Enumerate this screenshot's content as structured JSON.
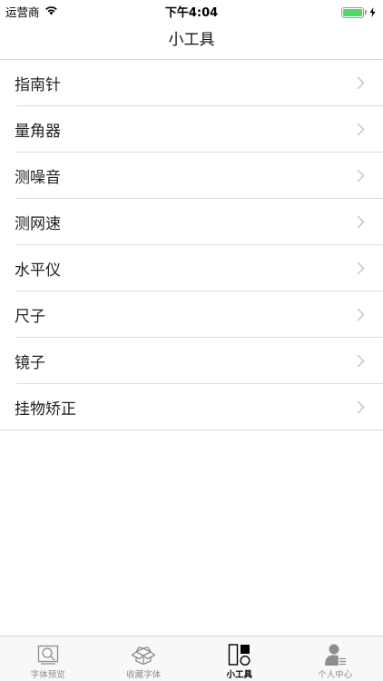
{
  "status_bar": {
    "carrier": "运营商",
    "time": "下午4:04",
    "battery_level": 1.0
  },
  "nav": {
    "title": "小工具"
  },
  "tools": [
    {
      "label": "指南针",
      "icon": "chevron-right-icon"
    },
    {
      "label": "量角器",
      "icon": "chevron-right-icon"
    },
    {
      "label": "测噪音",
      "icon": "chevron-right-icon"
    },
    {
      "label": "测网速",
      "icon": "chevron-right-icon"
    },
    {
      "label": "水平仪",
      "icon": "chevron-right-icon"
    },
    {
      "label": "尺子",
      "icon": "chevron-right-icon"
    },
    {
      "label": "镜子",
      "icon": "chevron-right-icon"
    },
    {
      "label": "挂物矫正",
      "icon": "chevron-right-icon"
    }
  ],
  "tab_bar": {
    "tabs": [
      {
        "label": "字体预览",
        "icon": "font-preview-icon",
        "active": false
      },
      {
        "label": "收藏字体",
        "icon": "favorites-box-icon",
        "active": false
      },
      {
        "label": "小工具",
        "icon": "tools-icon",
        "active": true
      },
      {
        "label": "个人中心",
        "icon": "person-icon",
        "active": false
      }
    ]
  },
  "colors": {
    "battery": "#4cd964",
    "chevron": "#c7c7cc",
    "tab_inactive": "#8e8e8e",
    "tab_active": "#000000"
  }
}
